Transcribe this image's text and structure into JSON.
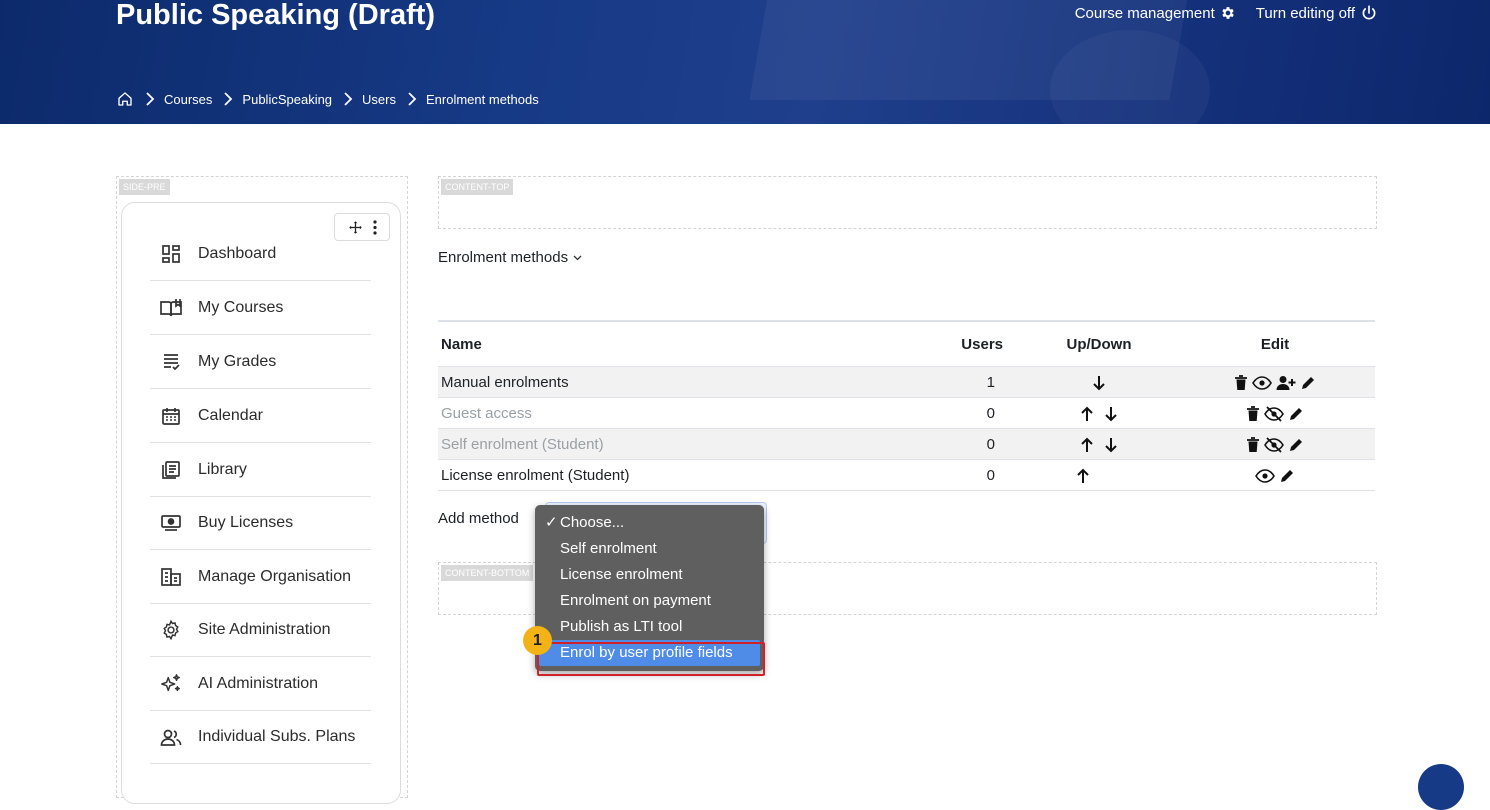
{
  "header": {
    "title": "Public Speaking (Draft)",
    "course_management": "Course management",
    "turn_editing": "Turn editing off"
  },
  "breadcrumb": [
    "Courses",
    "PublicSpeaking",
    "Users",
    "Enrolment methods"
  ],
  "regions": {
    "side_pre": "SIDE-PRE",
    "content_top": "CONTENT-TOP",
    "content_bottom": "CONTENT-BOTTOM"
  },
  "sidebar": {
    "items": [
      {
        "label": "Dashboard",
        "icon": "dashboard-icon"
      },
      {
        "label": "My Courses",
        "icon": "book-icon"
      },
      {
        "label": "My Grades",
        "icon": "grades-icon"
      },
      {
        "label": "Calendar",
        "icon": "calendar-icon"
      },
      {
        "label": "Library",
        "icon": "library-icon"
      },
      {
        "label": "Buy Licenses",
        "icon": "cash-icon"
      },
      {
        "label": "Manage Organisation",
        "icon": "building-icon"
      },
      {
        "label": "Site Administration",
        "icon": "gear-icon"
      },
      {
        "label": "AI Administration",
        "icon": "sparkle-icon"
      },
      {
        "label": "Individual Subs. Plans",
        "icon": "users-icon"
      }
    ]
  },
  "main": {
    "enrolment_methods_label": "Enrolment methods",
    "table": {
      "headers": [
        "Name",
        "Users",
        "Up/Down",
        "Edit"
      ],
      "rows": [
        {
          "name": "Manual enrolments",
          "users": "1",
          "updown": [
            "down"
          ],
          "edit": [
            "delete",
            "hide",
            "enrol-users",
            "edit"
          ],
          "dim": false
        },
        {
          "name": "Guest access",
          "users": "0",
          "updown": [
            "up",
            "down"
          ],
          "edit": [
            "delete",
            "show",
            "edit"
          ],
          "dim": true
        },
        {
          "name": "Self enrolment (Student)",
          "users": "0",
          "updown": [
            "up",
            "down"
          ],
          "edit": [
            "delete",
            "show",
            "edit"
          ],
          "dim": true
        },
        {
          "name": "License enrolment (Student)",
          "users": "0",
          "updown": [
            "up"
          ],
          "edit": [
            "hide",
            "edit"
          ],
          "dim": false
        }
      ]
    },
    "add_method_label": "Add method",
    "dropdown": {
      "selected": "Choose...",
      "options": [
        "Choose...",
        "Self enrolment",
        "License enrolment",
        "Enrolment on payment",
        "Publish as LTI tool",
        "Enrol by user profile fields"
      ],
      "highlighted": "Enrol by user profile fields"
    }
  },
  "annotation": {
    "step_number": "1"
  },
  "colors": {
    "header_bg": "#173a86",
    "highlight_blue": "#4f8ce8",
    "frame_red": "#d0202a",
    "marker_yellow": "#f3b317"
  }
}
